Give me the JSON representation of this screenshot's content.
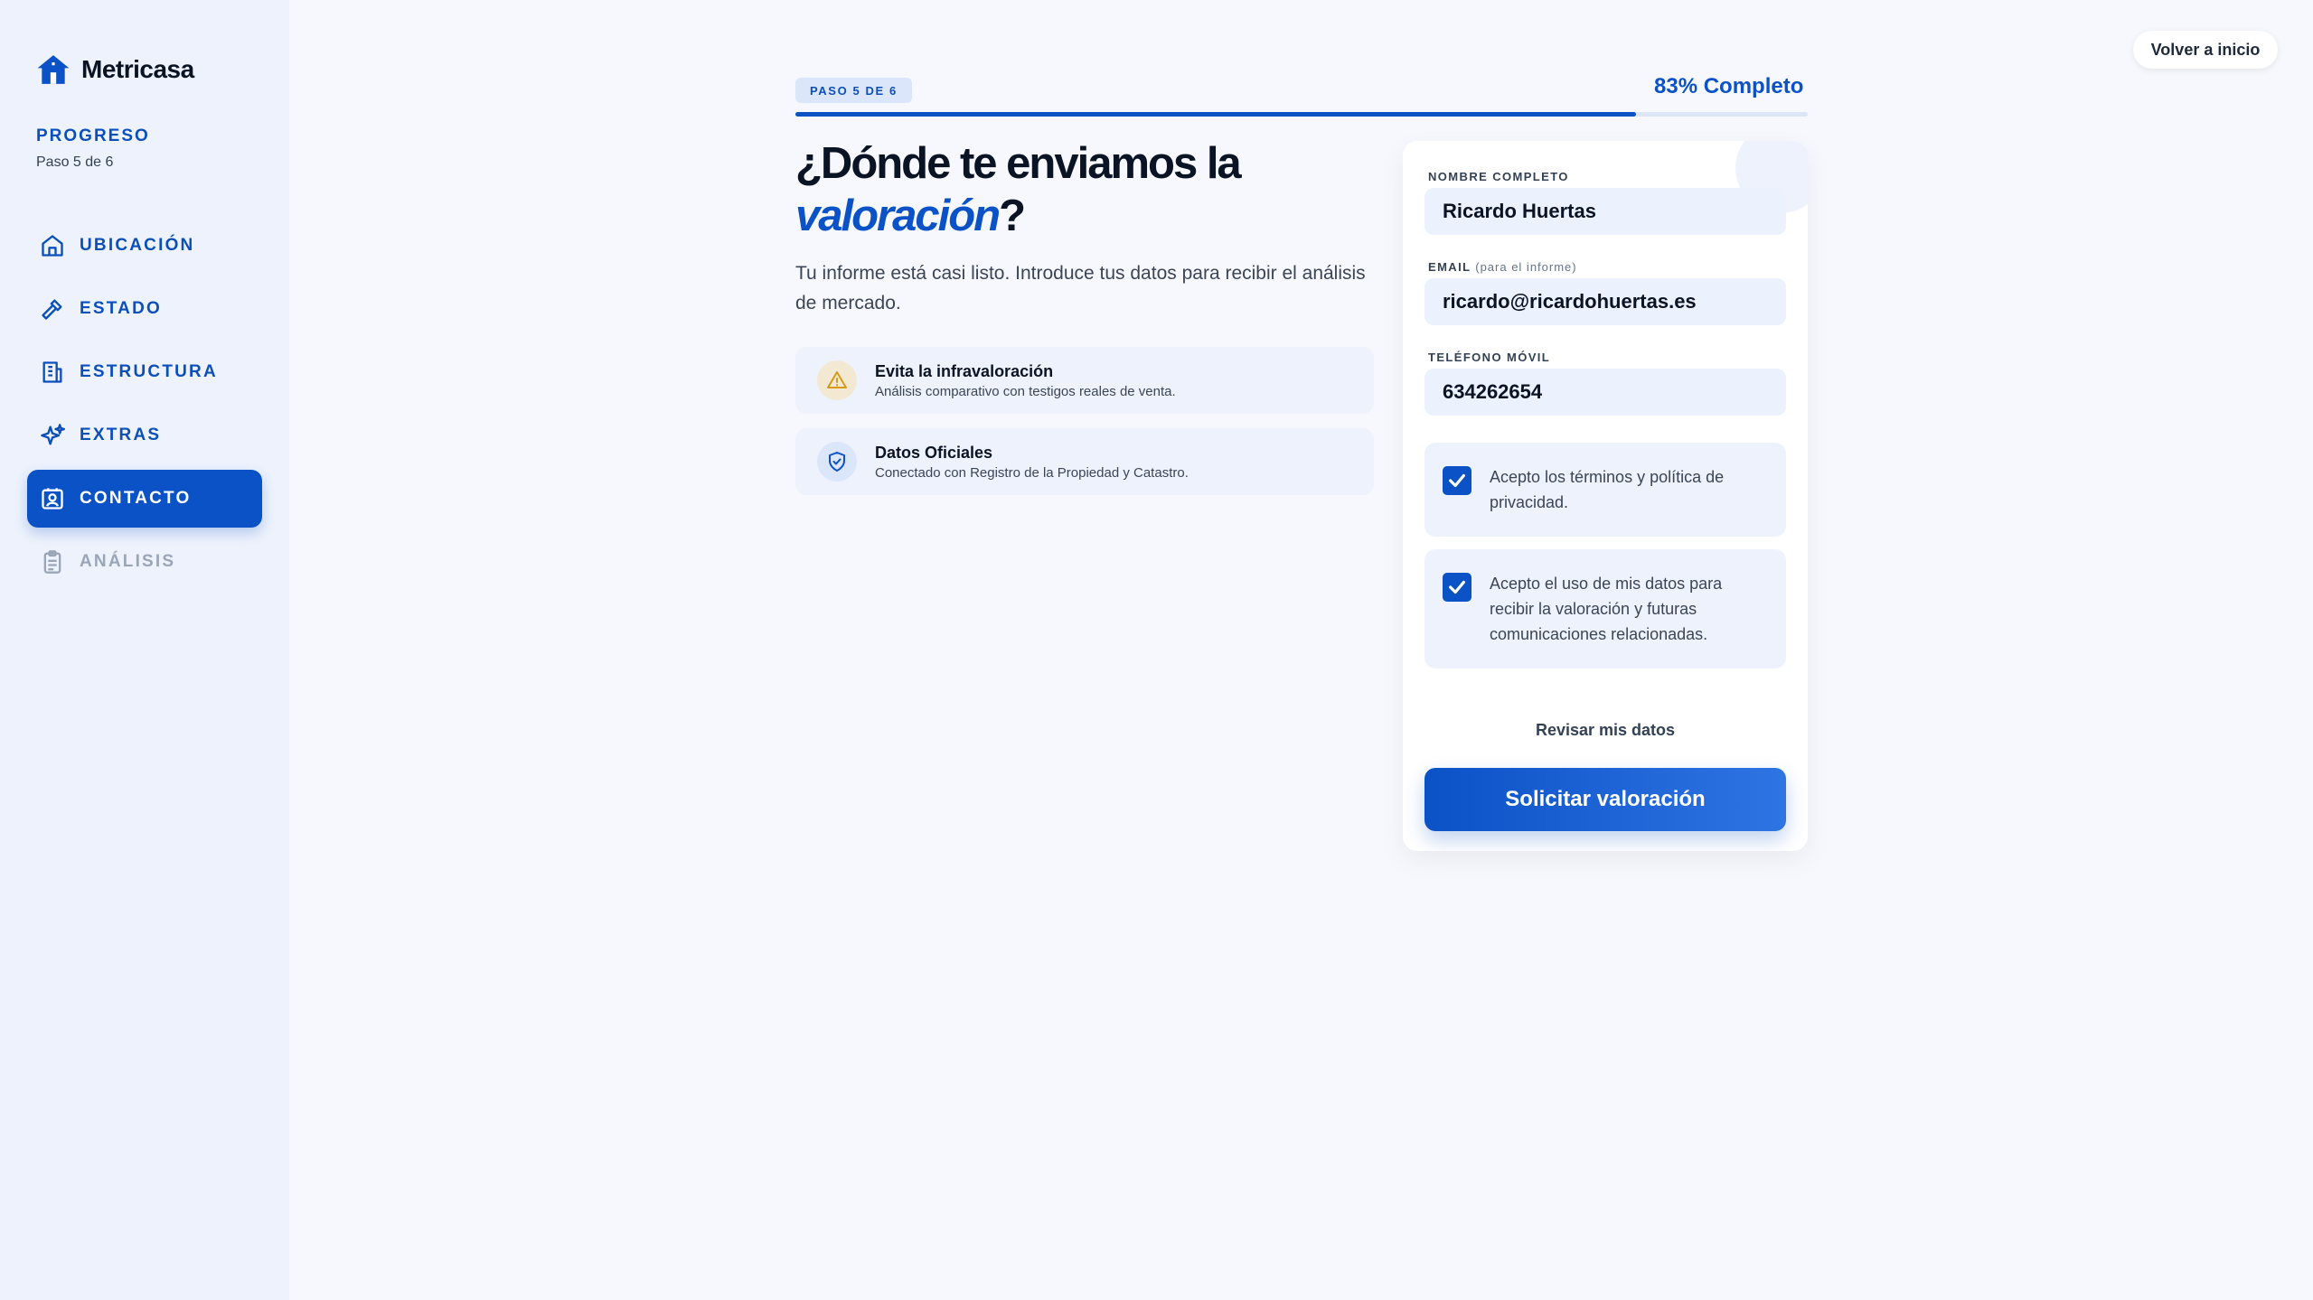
{
  "brand": {
    "name": "Metricasa"
  },
  "sidebar": {
    "progress_title": "PROGRESO",
    "progress_sub": "Paso 5 de 6",
    "items": [
      {
        "label": "UBICACIÓN",
        "icon": "home-icon",
        "state": "done"
      },
      {
        "label": "ESTADO",
        "icon": "hammer-icon",
        "state": "done"
      },
      {
        "label": "ESTRUCTURA",
        "icon": "building-icon",
        "state": "done"
      },
      {
        "label": "EXTRAS",
        "icon": "sparkles-icon",
        "state": "done"
      },
      {
        "label": "CONTACTO",
        "icon": "contact-icon",
        "state": "active"
      },
      {
        "label": "ANÁLISIS",
        "icon": "clipboard-icon",
        "state": "disabled"
      }
    ]
  },
  "header": {
    "home_button": "Volver a inicio"
  },
  "progress": {
    "step_badge": "PASO 5 DE 6",
    "percent_label": "83% Completo",
    "percent": 83
  },
  "main": {
    "headline_part1": "¿Dónde te enviamos la",
    "headline_em": "valoración",
    "headline_end": "?",
    "intro": "Tu informe está casi listo. Introduce tus datos para recibir el análisis de mercado.",
    "features": [
      {
        "title": "Evita la infravaloración",
        "desc": "Análisis comparativo con testigos reales de venta.",
        "icon": "warning-icon",
        "color": "#d59a16"
      },
      {
        "title": "Datos Oficiales",
        "desc": "Conectado con Registro de la Propiedad y Catastro.",
        "icon": "shield-check-icon",
        "color": "#0b52c7"
      }
    ]
  },
  "form": {
    "name_label": "NOMBRE COMPLETO",
    "name_value": "Ricardo Huertas",
    "email_label": "EMAIL",
    "email_hint": "(para el informe)",
    "email_value": "ricardo@ricardohuertas.es",
    "phone_label": "TELÉFONO MÓVIL",
    "phone_value": "634262654",
    "terms_text": "Acepto los términos y política de privacidad.",
    "terms_checked": true,
    "data_text": "Acepto el uso de mis datos para recibir la valoración y futuras comunicaciones relacionadas.",
    "data_checked": true,
    "review_link": "Revisar mis datos",
    "submit_label": "Solicitar valoración"
  },
  "colors": {
    "accent": "#0b52c7",
    "sidebar_bg": "#edf2fc",
    "page_bg": "#f6f8fd"
  }
}
